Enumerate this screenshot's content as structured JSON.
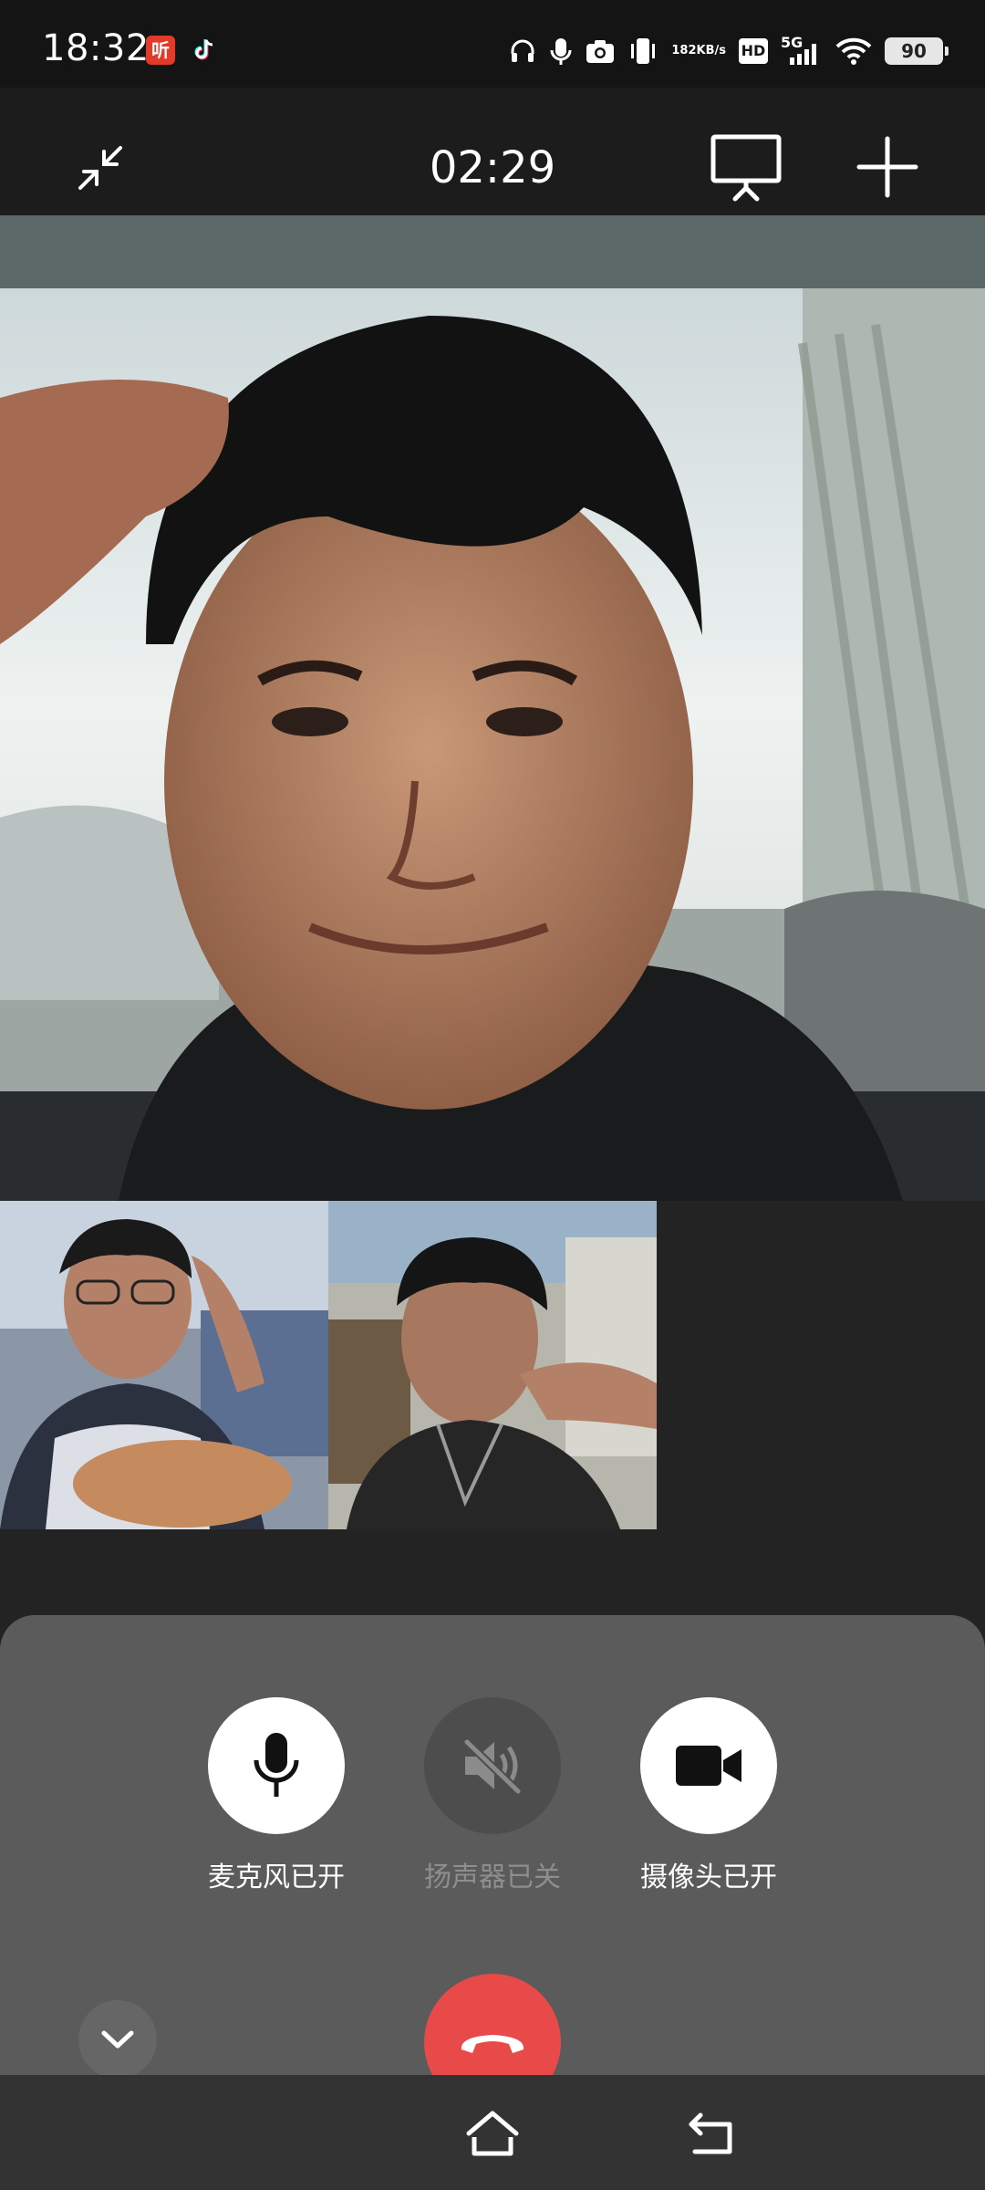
{
  "status_bar": {
    "time": "18:32",
    "app_badge": "听",
    "net_speed_value": "182",
    "net_speed_unit": "KB/s",
    "hd_label": "HD",
    "network_type": "5G",
    "battery": "90",
    "icons": [
      "headphones-icon",
      "mic-icon",
      "camera-icon",
      "vibrate-icon",
      "signal-icon",
      "wifi-icon",
      "battery-icon"
    ]
  },
  "call": {
    "duration": "02:29"
  },
  "controls": {
    "mic_label": "麦克风已开",
    "speaker_label": "扬声器已关",
    "camera_label": "摄像头已开"
  },
  "colors": {
    "hangup": "#e84a4a",
    "panel": "#5b5b5b",
    "background": "#232323"
  }
}
